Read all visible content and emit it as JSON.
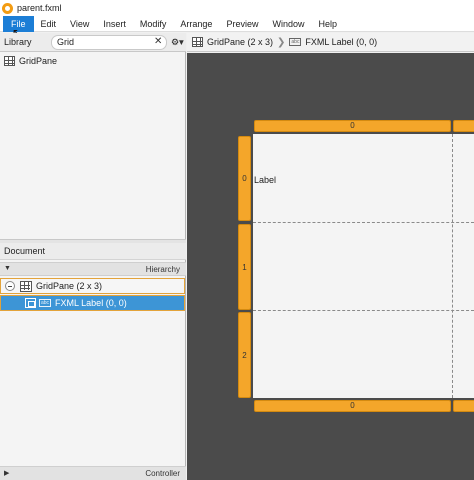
{
  "window": {
    "title": "parent.fxml"
  },
  "menu": [
    "File",
    "Edit",
    "View",
    "Insert",
    "Modify",
    "Arrange",
    "Preview",
    "Window",
    "Help"
  ],
  "library": {
    "title": "Library",
    "search_value": "Grid",
    "items": [
      "GridPane"
    ]
  },
  "document": {
    "title": "Document",
    "hierarchy_label": "Hierarchy",
    "tree": [
      {
        "label": "GridPane (2 x 3)"
      },
      {
        "label": "FXML Label (0, 0)"
      }
    ],
    "controller_label": "Controller"
  },
  "breadcrumb": {
    "items": [
      "GridPane (2 x 3)",
      "FXML Label (0, 0)"
    ],
    "label_icon_text": "abc"
  },
  "canvas": {
    "column_handles_top": [
      "0"
    ],
    "column_handles_bottom": [
      "0"
    ],
    "row_handles": [
      "0",
      "1",
      "2"
    ],
    "cell_label": "Label"
  },
  "colors": {
    "accent": "#1c7ed6",
    "selection": "#3d95d6",
    "handle": "#f4a62a",
    "canvas_bg": "#4b4b4b"
  }
}
